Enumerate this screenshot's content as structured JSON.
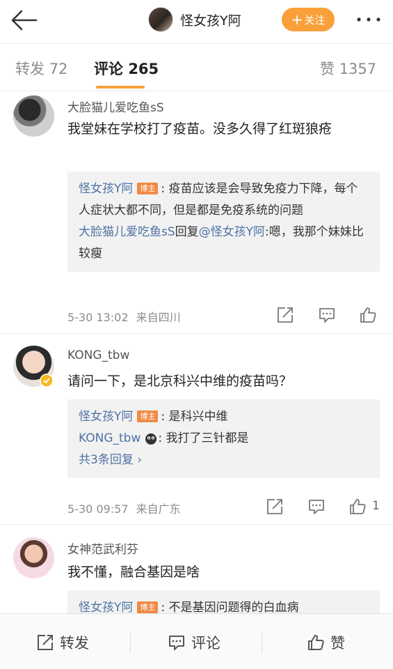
{
  "header": {
    "title": "怪女孩Y阿",
    "follow_label": "关注",
    "follow_plus": "+"
  },
  "tabs": [
    {
      "label": "转发",
      "count": "72"
    },
    {
      "label": "评论",
      "count": "265"
    },
    {
      "label": "赞",
      "count": "1357"
    }
  ],
  "comments": [
    {
      "user": "大脸猫儿爱吃鱼sS",
      "text": "我堂妹在学校打了疫苗。没多久得了红斑狼疮",
      "replies": [
        {
          "name": "怪女孩Y阿",
          "badge": "博主",
          "text": ": 疫苗应该是会导致免疫力下降，每个人症状大都不同，但是都是免疫系统的问题"
        },
        {
          "name": "大脸猫儿爱吃鱼sS",
          "mid": "回复",
          "mention": "@怪女孩Y阿",
          "text": ":嗯，我那个妹妹比较瘦"
        }
      ],
      "time": "5-30 13:02",
      "location": "来自四川",
      "likes": ""
    },
    {
      "user": "KONG_tbw",
      "text": "请问一下，是北京科兴中维的疫苗吗？",
      "replies": [
        {
          "name": "怪女孩Y阿",
          "badge": "博主",
          "text": ": 是科兴中维"
        },
        {
          "name": "KONG_tbw",
          "text": ": 我打了三针都是",
          "emoji": "sob-face-icon"
        }
      ],
      "more_replies": "共3条回复 ",
      "time": "5-30 09:57",
      "location": "来自广东",
      "likes": "1"
    },
    {
      "user": "女神范武利芬",
      "text": "我不懂，融合基因是啥",
      "replies": [
        {
          "name": "怪女孩Y阿",
          "badge": "博主",
          "text": ": 不是基因问题得的白血病"
        }
      ]
    }
  ],
  "bottom_bar": {
    "repost": "转发",
    "comment": "评论",
    "like": "赞"
  },
  "colors": {
    "accent_orange": "#f9a03b",
    "link_blue": "#4e73a5",
    "badge_orange": "#f08a45"
  }
}
